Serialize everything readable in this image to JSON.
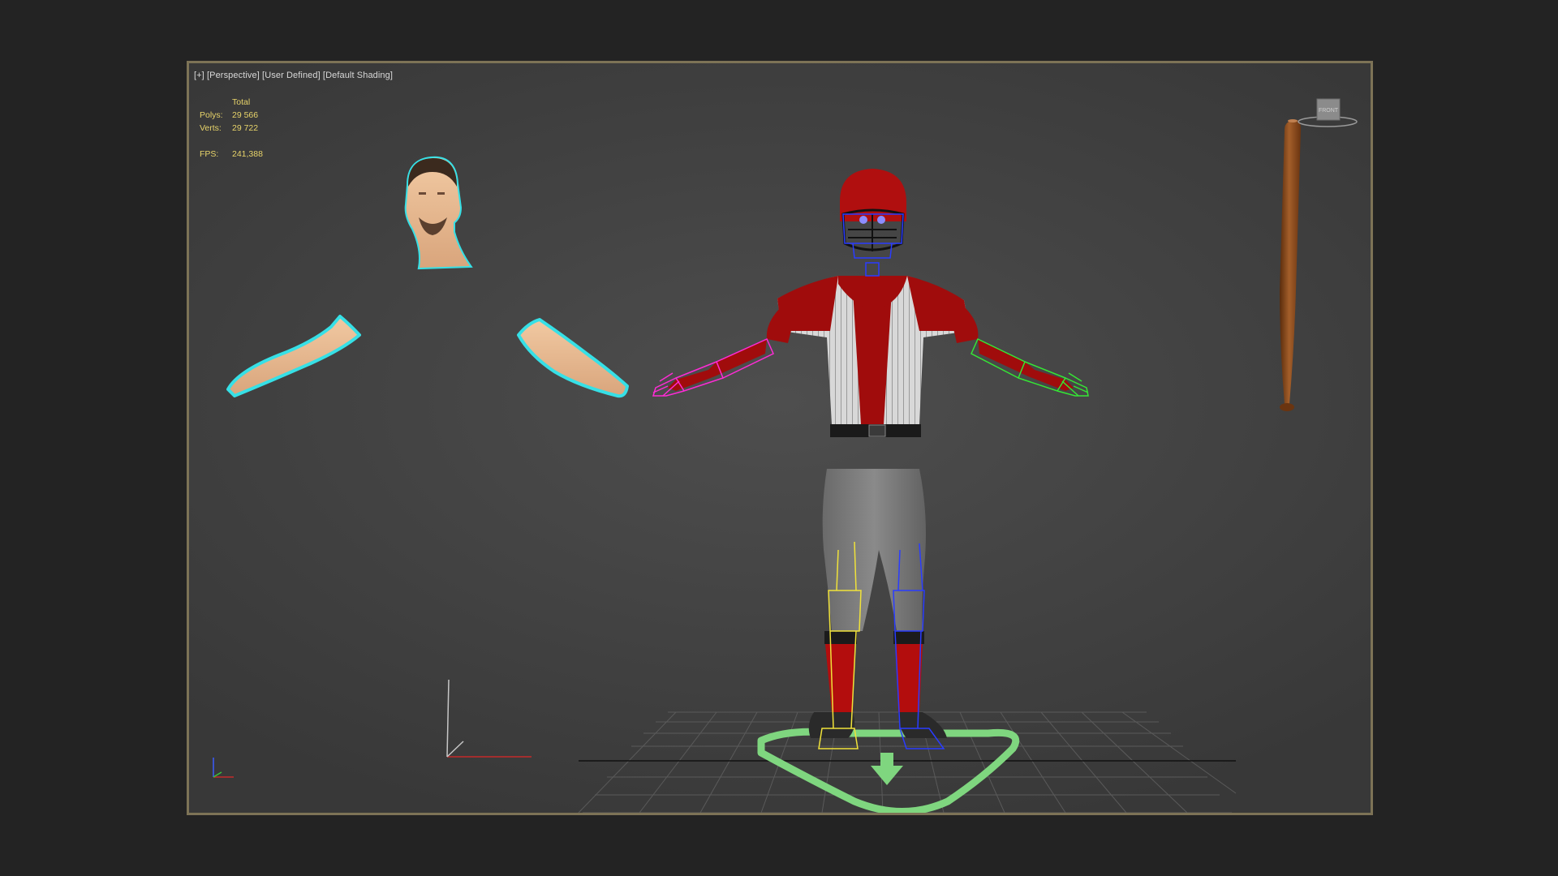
{
  "viewport": {
    "label_parts": [
      "[+]",
      "[Perspective]",
      "[User Defined]",
      "[Default Shading]"
    ],
    "border_color": "#7d7356"
  },
  "stats": {
    "column_header": "Total",
    "polys_label": "Polys:",
    "polys_value": "29 566",
    "verts_label": "Verts:",
    "verts_value": "29 722",
    "fps_label": "FPS:",
    "fps_value": "241,388",
    "text_color": "#e8d46a"
  },
  "viewcube": {
    "face_label": "FRONT"
  },
  "colors": {
    "selection_outline": "#36e0e6",
    "jersey_red": "#9e0b0b",
    "left_arm_rig": "#ff2bd6",
    "right_arm_rig": "#35e635",
    "left_leg_rig": "#f0e23a",
    "right_leg_rig": "#2a3cff",
    "root_control": "#7fd67f",
    "bat": "#8a4a1c"
  },
  "icons": [
    "viewcube-icon",
    "axis-tripod-icon",
    "world-axis-icon",
    "root-arrow-icon"
  ]
}
